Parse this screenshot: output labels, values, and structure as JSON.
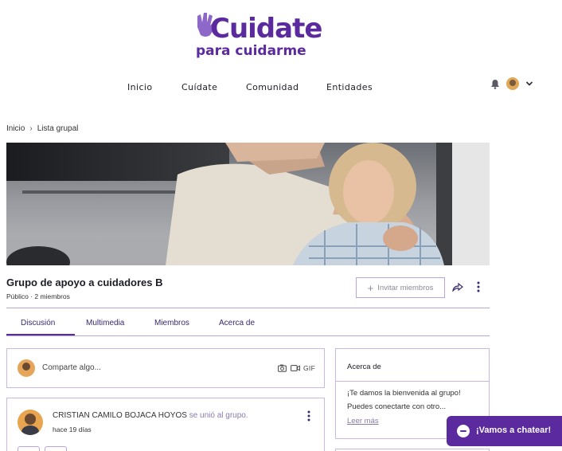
{
  "brand": {
    "name": "Cuidate",
    "tagline": "para cuidarme",
    "color": "#5b2a9e"
  },
  "nav": {
    "items": [
      "Inicio",
      "Cuídate",
      "Comunidad",
      "Entidades"
    ],
    "icons": [
      "bell-icon",
      "avatar",
      "chevron-down-icon"
    ]
  },
  "breadcrumb": {
    "items": [
      "Inicio",
      "Lista grupal"
    ]
  },
  "group": {
    "title": "Grupo de apoyo a cuidadores B",
    "meta": "Público · 2 miembros",
    "invite_label": "Invitar miembros"
  },
  "tabs": {
    "items": [
      "Discusión",
      "Multimedia",
      "Miembros",
      "Acerca de"
    ],
    "active": "Discusión"
  },
  "composer": {
    "placeholder": "Comparte algo...",
    "gif_label": "GIF"
  },
  "post": {
    "author": "CRISTIAN CAMILO BOJACA HOYOS",
    "action": "se unió al grupo.",
    "time": "hace 19 días"
  },
  "about": {
    "title": "Acerca de",
    "line1": "¡Te damos la bienvenida al grupo!",
    "line2": "Puedes conectarte con otro...",
    "link": "Leer más"
  },
  "chat": {
    "label": "¡Vamos a chatear!"
  }
}
